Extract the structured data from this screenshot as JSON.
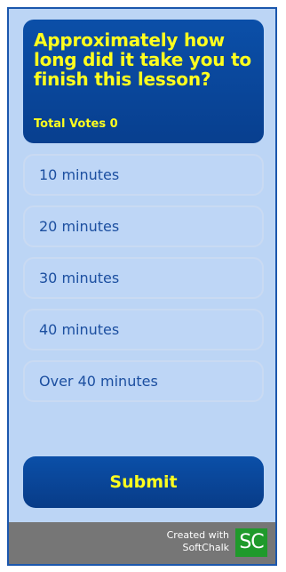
{
  "question": {
    "text": "Approximately how long did it take you to finish this lesson?",
    "votes_label": "Total Votes 0"
  },
  "options": [
    {
      "label": "10 minutes"
    },
    {
      "label": "20 minutes"
    },
    {
      "label": "30 minutes"
    },
    {
      "label": "40 minutes"
    },
    {
      "label": "Over 40 minutes"
    }
  ],
  "submit_label": "Submit",
  "footer": {
    "line1": "Created with",
    "line2": "SoftChalk",
    "logo_text": "SC"
  },
  "colors": {
    "panel_bg": "#bcd5f5",
    "border": "#1b57ad",
    "question_bg": "#0b4fa8",
    "question_text": "#ffff1e",
    "option_text": "#1c4fa0",
    "footer_bg": "#767676",
    "logo_bg": "#1f9a2b"
  }
}
